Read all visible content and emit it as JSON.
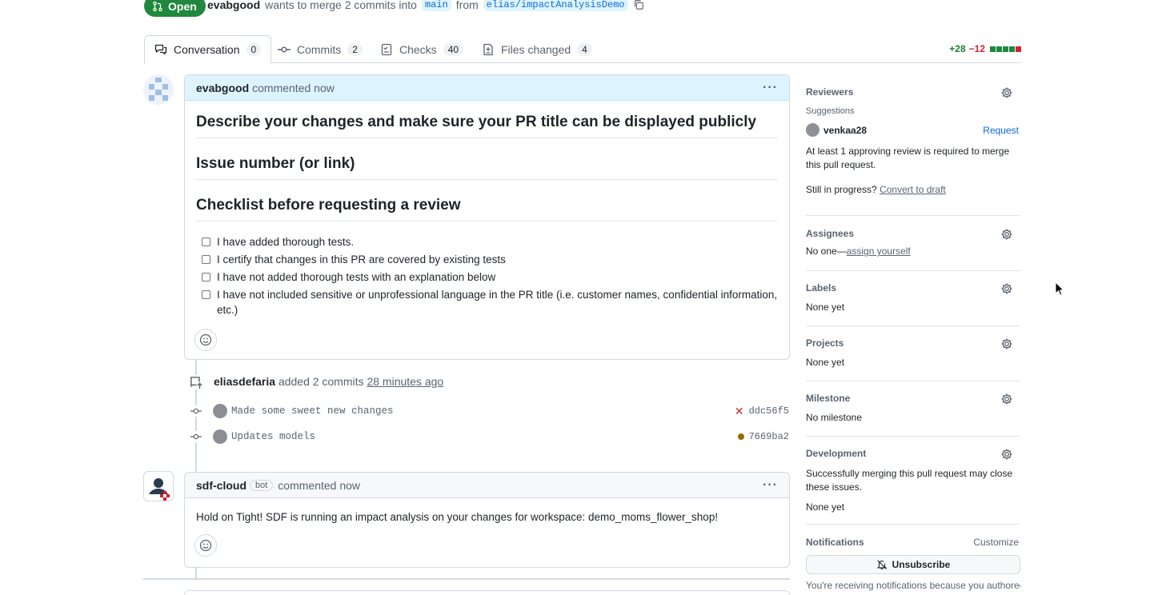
{
  "header": {
    "state": "Open",
    "author": "evabgood",
    "wants_text": "wants to merge 2 commits into",
    "base_branch": "main",
    "from_text": "from",
    "head_branch": "elias/impactAnalysisDemo"
  },
  "tabs": [
    {
      "label": "Conversation",
      "count": "0"
    },
    {
      "label": "Commits",
      "count": "2"
    },
    {
      "label": "Checks",
      "count": "40"
    },
    {
      "label": "Files changed",
      "count": "4"
    }
  ],
  "diffstat": {
    "additions": "+28",
    "deletions": "−12"
  },
  "comment1": {
    "author": "evabgood",
    "action": "commented now",
    "h1": "Describe your changes and make sure your PR title can be displayed publicly",
    "h2": "Issue number (or link)",
    "h3": "Checklist before requesting a review",
    "tasks": [
      "I have added thorough tests.",
      "I certify that changes in this PR are covered by existing tests",
      "I have not added thorough tests with an explanation below",
      "I have not included sensitive or unprofessional language in the PR title (i.e. customer names, confidential information, etc.)"
    ]
  },
  "commits_event": {
    "actor": "eliasdefaria",
    "action": "added 2 commits",
    "time": "28 minutes ago",
    "commits": [
      {
        "message": "Made some sweet new changes",
        "sha": "ddc56f5",
        "status": "failed"
      },
      {
        "message": "Updates models",
        "sha": "7669ba2",
        "status": "pending"
      }
    ]
  },
  "comment2": {
    "author": "sdf-cloud",
    "badge": "bot",
    "action": "commented now",
    "body": "Hold on Tight! SDF is running an impact analysis on your changes for workspace: demo_moms_flower_shop!"
  },
  "sidebar": {
    "reviewers": {
      "title": "Reviewers",
      "suggestions": "Suggestions",
      "suggested_user": "venkaa28",
      "request": "Request",
      "note": "At least 1 approving review is required to merge this pull request.",
      "draft_prefix": "Still in progress?",
      "draft_link": "Convert to draft"
    },
    "assignees": {
      "title": "Assignees",
      "prefix": "No one—",
      "link": "assign yourself"
    },
    "labels": {
      "title": "Labels",
      "value": "None yet"
    },
    "projects": {
      "title": "Projects",
      "value": "None yet"
    },
    "milestone": {
      "title": "Milestone",
      "value": "No milestone"
    },
    "development": {
      "title": "Development",
      "note": "Successfully merging this pull request may close these issues.",
      "value": "None yet"
    },
    "notifications": {
      "title": "Notifications",
      "customize": "Customize",
      "button": "Unsubscribe",
      "note": "You're receiving notifications because you authored"
    }
  },
  "colors": {
    "green": "#1f883d",
    "accent": "#0969da",
    "comment_head": "#ddf4ff",
    "red": "#d1242f"
  }
}
